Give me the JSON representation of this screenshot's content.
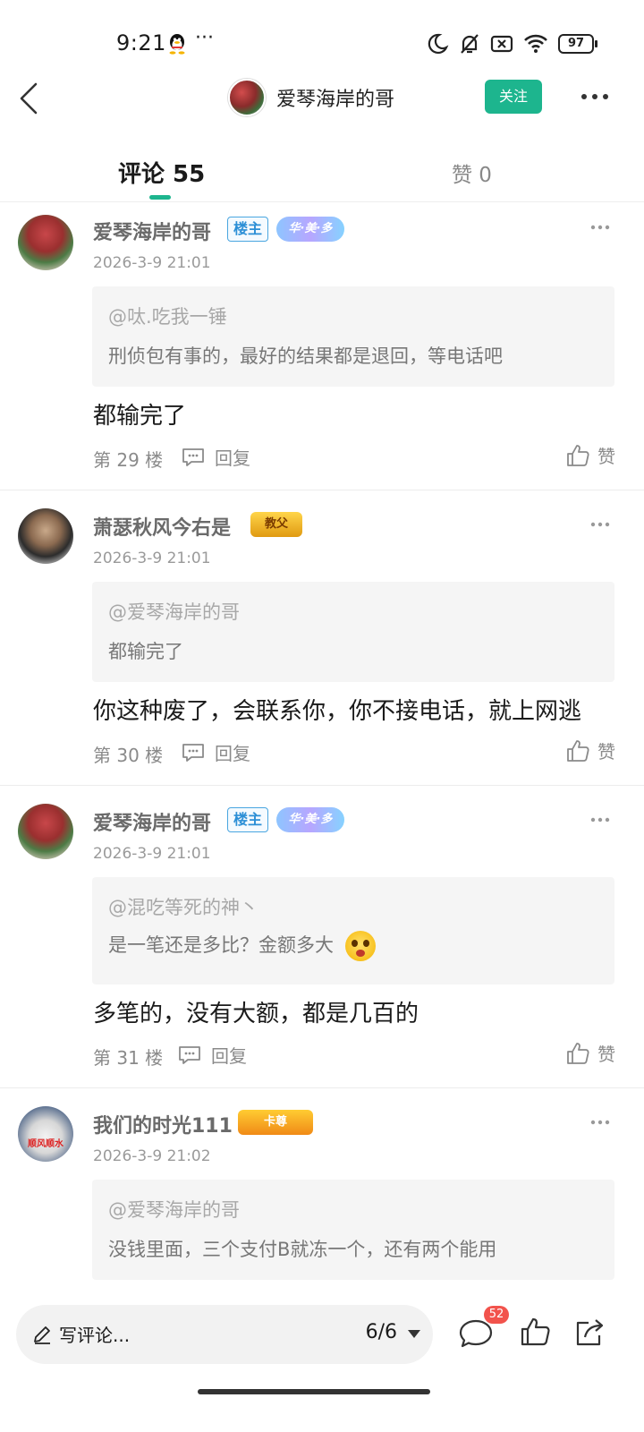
{
  "status_bar": {
    "time": "9:21",
    "dots": "···",
    "battery": "97"
  },
  "header": {
    "title": "爱琴海岸的哥",
    "follow_label": "关注"
  },
  "tabs": {
    "comments": "评论 55",
    "likes": "赞 0"
  },
  "comments": [
    {
      "name": "爱琴海岸的哥",
      "badge_host": "楼主",
      "badge_extra": "华·美·多",
      "time": "2026-3-9 21:01",
      "quote_at": "@呔.吃我一锤",
      "quote_text": "刑侦包有事的，最好的结果都是退回，等电话吧",
      "body": "都输完了",
      "floor": "第 29 楼",
      "reply": "回复",
      "like": "赞"
    },
    {
      "name": "萧瑟秋风今右是",
      "badge_extra": "教父",
      "time": "2026-3-9 21:01",
      "quote_at": "@爱琴海岸的哥",
      "quote_text": "都输完了",
      "body": "你这种废了，会联系你，你不接电话，就上网逃",
      "floor": "第 30 楼",
      "reply": "回复",
      "like": "赞"
    },
    {
      "name": "爱琴海岸的哥",
      "badge_host": "楼主",
      "badge_extra": "华·美·多",
      "time": "2026-3-9 21:01",
      "quote_at": "@混吃等死的神丶",
      "quote_text": "是一笔还是多比？金额多大",
      "body": "多笔的，没有大额，都是几百的",
      "floor": "第 31 楼",
      "reply": "回复",
      "like": "赞"
    },
    {
      "name": "我们的时光111",
      "badge_extra": "卡尊",
      "avatar_text": "顺风顺水",
      "time": "2026-3-9 21:02",
      "quote_at": "@爱琴海岸的哥",
      "quote_text": "没钱里面，三个支付B就冻一个，还有两个能用"
    }
  ],
  "bottom_bar": {
    "write_placeholder": "写评论...",
    "page_indicator": "6/6",
    "comment_count": "52"
  },
  "colors": {
    "accent": "#1db58e",
    "badge_red": "#f2534c",
    "host_blue": "#2c8fd6"
  }
}
